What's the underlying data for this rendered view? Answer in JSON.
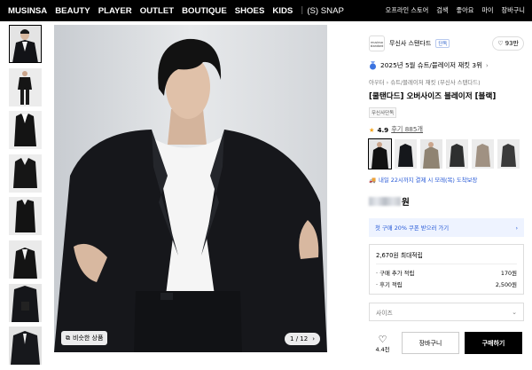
{
  "nav": {
    "left": [
      "MUSINSA",
      "BEAUTY",
      "PLAYER",
      "OUTLET",
      "BOUTIQUE",
      "SHOES",
      "KIDS"
    ],
    "snap": "(S) SNAP",
    "right": [
      "오프라인 스토어",
      "검색",
      "좋아요",
      "마이",
      "장바구니"
    ]
  },
  "gallery": {
    "similar_label": "비슷한 상품",
    "counter": "1 / 12"
  },
  "product": {
    "brand_logo_text": "musinsa standard",
    "brand": "무신사 스탠다드",
    "brand_badge": "단독",
    "likes": "93만",
    "ranking": "2025년 5월 슈트/블레이저 재킷 3위",
    "category": "아우터 › 슈트/블레이저 재킷 (무신사 스탠다드)",
    "name": "[쿨탠다드] 오버사이즈 블레이저 [블랙]",
    "exclusive_tag": "무신사단독",
    "rating": "4.9",
    "reviews": "후기 885개",
    "delivery": "내일 22시까지 결제 시 모레(목) 도착보장",
    "price_suffix": "원",
    "coupon": "첫 구매 20% 쿠폰 받으러 가기",
    "points": {
      "max": "2,670원 최대적립",
      "rows": [
        {
          "label": "· 구매 추가 적립",
          "value": "170원"
        },
        {
          "label": "· 후기 적립",
          "value": "2,500원"
        }
      ]
    },
    "size_placeholder": "사이즈"
  },
  "colors": [
    "#111111",
    "#15171b",
    "#8f8372",
    "#2e2f2f",
    "#a09182",
    "#3a3a3a"
  ],
  "bottom": {
    "like_count": "4.4천",
    "cart": "장바구니",
    "buy": "구매하기"
  }
}
